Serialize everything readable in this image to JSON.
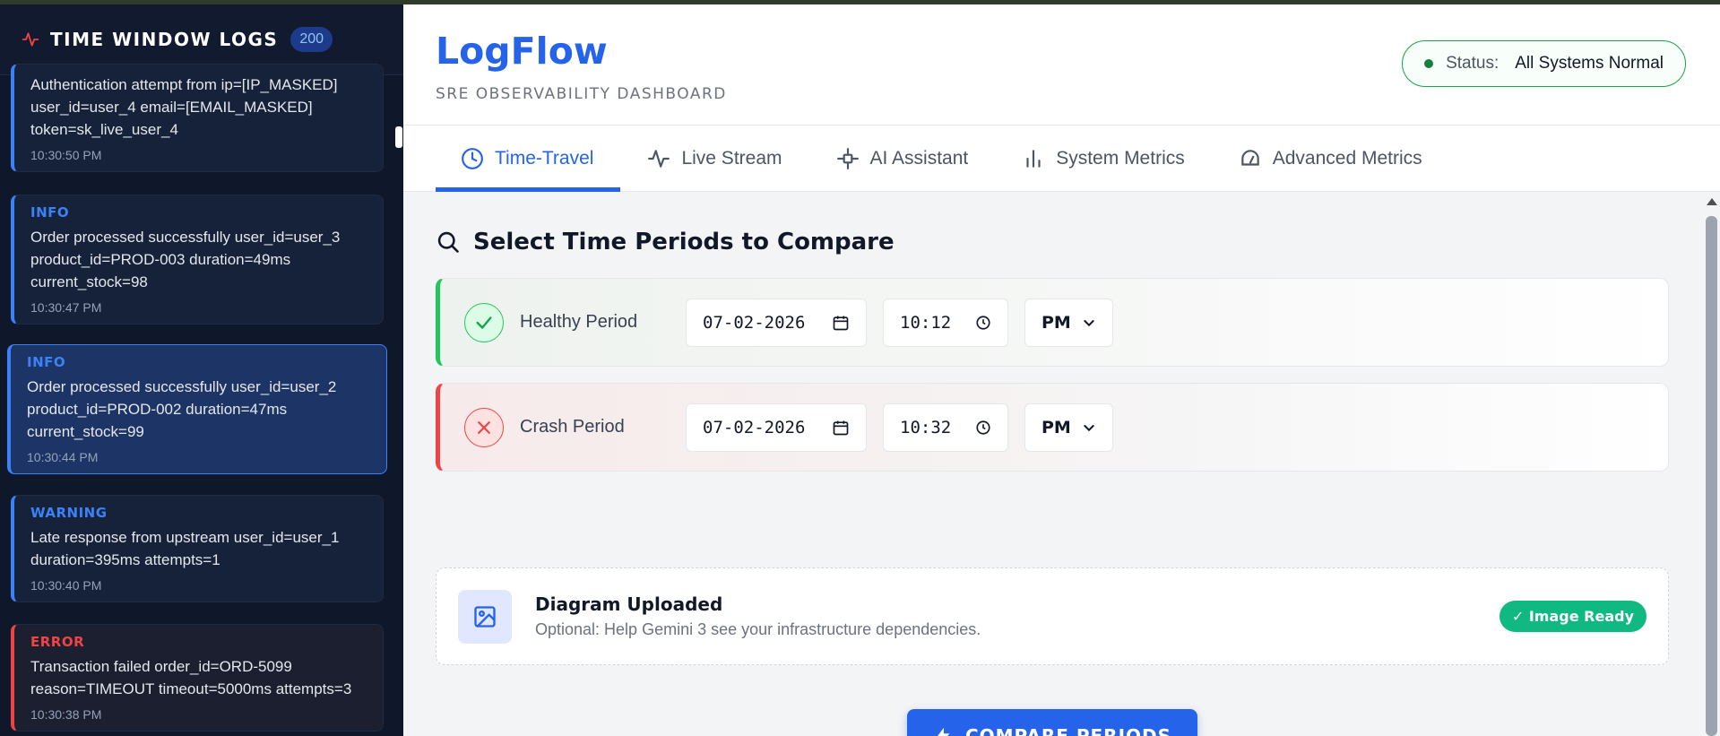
{
  "sidebar": {
    "title": "TIME WINDOW LOGS",
    "count": "200",
    "logs": [
      {
        "level": "",
        "message": "Authentication attempt from ip=[IP_MASKED] user_id=user_4 email=[EMAIL_MASKED] token=sk_live_user_4",
        "time": "10:30:50 PM"
      },
      {
        "level": "INFO",
        "message": "Order processed successfully user_id=user_3 product_id=PROD-003 duration=49ms current_stock=98",
        "time": "10:30:47 PM"
      },
      {
        "level": "INFO",
        "message": "Order processed successfully user_id=user_2 product_id=PROD-002 duration=47ms current_stock=99",
        "time": "10:30:44 PM"
      },
      {
        "level": "WARNING",
        "message": "Late response from upstream user_id=user_1 duration=395ms attempts=1",
        "time": "10:30:40 PM"
      },
      {
        "level": "ERROR",
        "message": "Transaction failed order_id=ORD-5099 reason=TIMEOUT timeout=5000ms attempts=3",
        "time": "10:30:38 PM"
      }
    ]
  },
  "header": {
    "brand": "LogFlow",
    "subtitle": "SRE OBSERVABILITY DASHBOARD",
    "status_label": "Status:",
    "status_value": "All Systems Normal"
  },
  "tabs": [
    {
      "label": "Time-Travel",
      "icon": "clock-icon",
      "active": true
    },
    {
      "label": "Live Stream",
      "icon": "pulse-icon"
    },
    {
      "label": "AI Assistant",
      "icon": "robot-icon"
    },
    {
      "label": "System Metrics",
      "icon": "bar-chart-icon"
    },
    {
      "label": "Advanced Metrics",
      "icon": "gauge-icon"
    }
  ],
  "compare": {
    "title": "Select Time Periods to Compare",
    "healthy": {
      "label": "Healthy Period",
      "date": "07-02-2026",
      "time": "10:12",
      "ampm": "PM"
    },
    "crash": {
      "label": "Crash Period",
      "date": "07-02-2026",
      "time": "10:32",
      "ampm": "PM"
    }
  },
  "upload": {
    "title": "Diagram Uploaded",
    "subtitle": "Optional: Help Gemini 3 see your infrastructure dependencies.",
    "badge": "✓ Image Ready"
  },
  "button": {
    "compare_label": "COMPARE PERIODS"
  },
  "colors": {
    "accent": "#2563eb",
    "healthy": "#22c55e",
    "crash": "#ef4444",
    "sidebar_bg": "#0f172a"
  }
}
